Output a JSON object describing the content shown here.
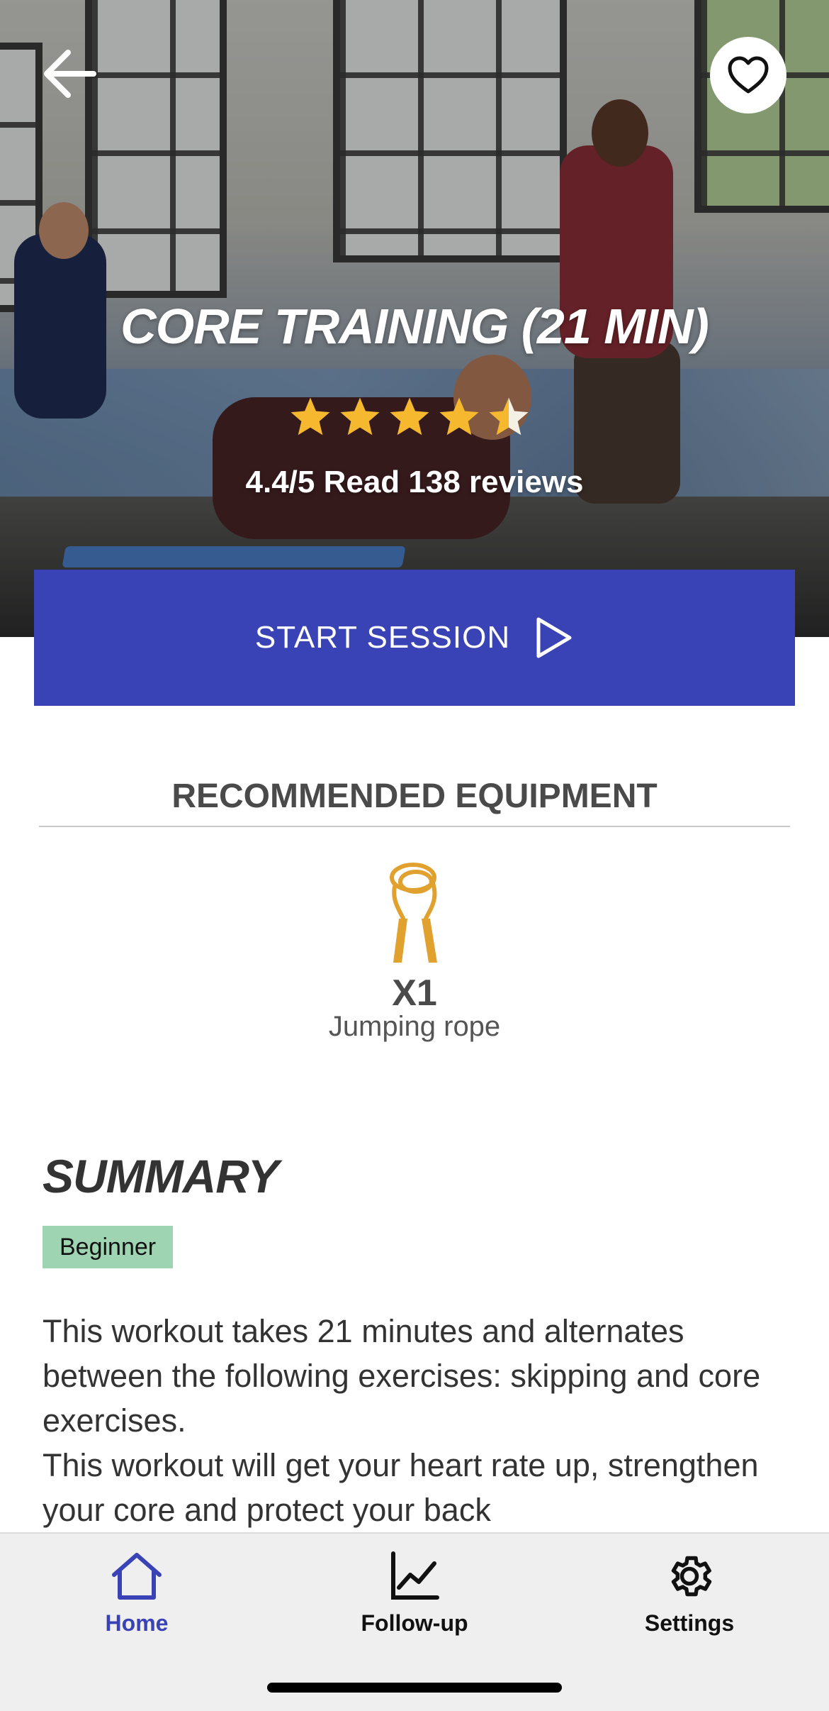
{
  "header": {
    "title": "CORE TRAINING (21 MIN)",
    "rating_text": "4.4/5 Read 138 reviews",
    "rating_value": 4.4,
    "rating_max": 5,
    "back_icon": "arrow-left-icon",
    "favorite_icon": "heart-icon"
  },
  "actions": {
    "start_label": "START SESSION",
    "start_icon": "play-icon"
  },
  "equipment": {
    "heading": "RECOMMENDED EQUIPMENT",
    "items": [
      {
        "quantity": "X1",
        "name": "Jumping rope",
        "icon": "jump-rope-icon"
      }
    ]
  },
  "summary": {
    "title": "SUMMARY",
    "level": "Beginner",
    "paragraphs": [
      "This workout takes 21 minutes and alternates between the following exercises: skipping and core exercises.",
      "This workout will get your heart rate up, strengthen your core and protect your back"
    ]
  },
  "tabbar": {
    "tabs": [
      {
        "label": "Home",
        "icon": "home-icon",
        "active": true
      },
      {
        "label": "Follow-up",
        "icon": "chart-line-icon",
        "active": false
      },
      {
        "label": "Settings",
        "icon": "gear-icon",
        "active": false
      }
    ]
  },
  "colors": {
    "accent": "#3a43b6",
    "star": "#f5b82e",
    "badge": "#9fd4b3",
    "equipment": "#e0a12e"
  }
}
